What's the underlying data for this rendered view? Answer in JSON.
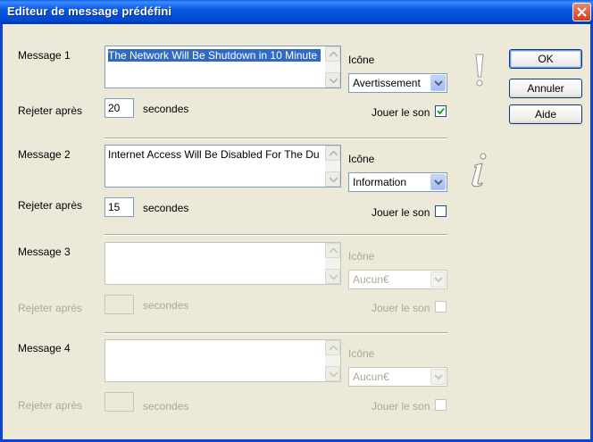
{
  "window": {
    "title": "Editeur de message prédéfini"
  },
  "labels": {
    "icon": "Icône",
    "reject_after": "Rejeter après",
    "seconds": "secondes",
    "play_sound": "Jouer le son"
  },
  "messages": [
    {
      "label": "Message 1",
      "text": "The Network Will Be Shutdown in 10 Minute",
      "seconds": "20",
      "icon": "Avertissement",
      "play_sound": true,
      "enabled": true,
      "icon_glyph": "exclamation-icon"
    },
    {
      "label": "Message 2",
      "text": "Internet Access Will Be Disabled For The Du",
      "seconds": "15",
      "icon": "Information",
      "play_sound": false,
      "enabled": true,
      "icon_glyph": "information-icon"
    },
    {
      "label": "Message 3",
      "text": "",
      "seconds": "",
      "icon": "Aucun€",
      "play_sound": false,
      "enabled": false
    },
    {
      "label": "Message 4",
      "text": "",
      "seconds": "",
      "icon": "Aucun€",
      "play_sound": false,
      "enabled": false
    }
  ],
  "buttons": {
    "ok": "OK",
    "cancel": "Annuler",
    "help": "Aide"
  },
  "colors": {
    "title_bar": "#0a57e0",
    "selection": "#316ac5",
    "dialog_bg": "#ece9d8"
  }
}
